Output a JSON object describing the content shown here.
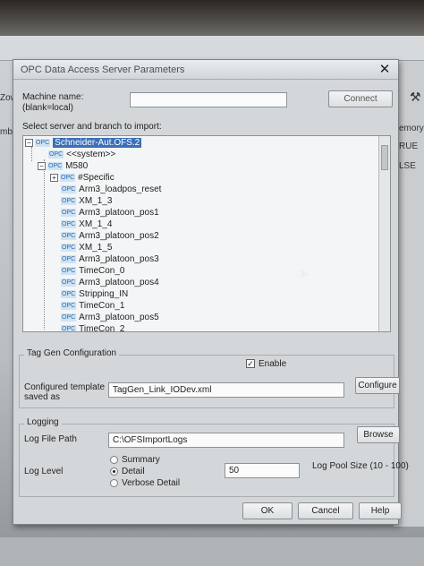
{
  "background": {
    "left_text_1": "Zow",
    "left_text_2": "mbe",
    "right_text_1": "emory",
    "right_text_2": "RUE",
    "right_text_3": "LSE"
  },
  "dialog": {
    "title": "OPC Data Access Server Parameters",
    "close_glyph": "✕",
    "machine_label_1": "Machine name:",
    "machine_label_2": "(blank=local)",
    "machine_value": "",
    "connect_label": "Connect",
    "select_label": "Select server and branch to import:",
    "tree": {
      "root": "Schneider-Aut.OFS.2",
      "system": "<<system>>",
      "m580": "M580",
      "items": [
        "#Specific",
        "Arm3_loadpos_reset",
        "XM_1_3",
        "Arm3_platoon_pos1",
        "XM_1_4",
        "Arm3_platoon_pos2",
        "XM_1_5",
        "Arm3_platoon_pos3",
        "TimeCon_0",
        "Arm3_platoon_pos4",
        "Stripping_IN",
        "TimeCon_1",
        "Arm3_platoon_pos5",
        "TimeCon_2"
      ]
    },
    "taggen": {
      "group_title": "Tag Gen Configuration",
      "enable_label": "Enable",
      "enable_checked": true,
      "template_label_1": "Configured template",
      "template_label_2": "saved as",
      "template_value": "TagGen_Link_IODev.xml",
      "configure_label": "Configure"
    },
    "logging": {
      "group_title": "Logging",
      "path_label": "Log File Path",
      "path_value": "C:\\OFSImportLogs",
      "browse_label": "Browse",
      "level_label": "Log Level",
      "opt_summary": "Summary",
      "opt_detail": "Detail",
      "opt_verbose": "Verbose Detail",
      "selected": "Detail",
      "pool_value": "50",
      "pool_label": "Log Pool Size (10 - 100)"
    },
    "ok_label": "OK",
    "cancel_label": "Cancel",
    "help_label": "Help"
  }
}
